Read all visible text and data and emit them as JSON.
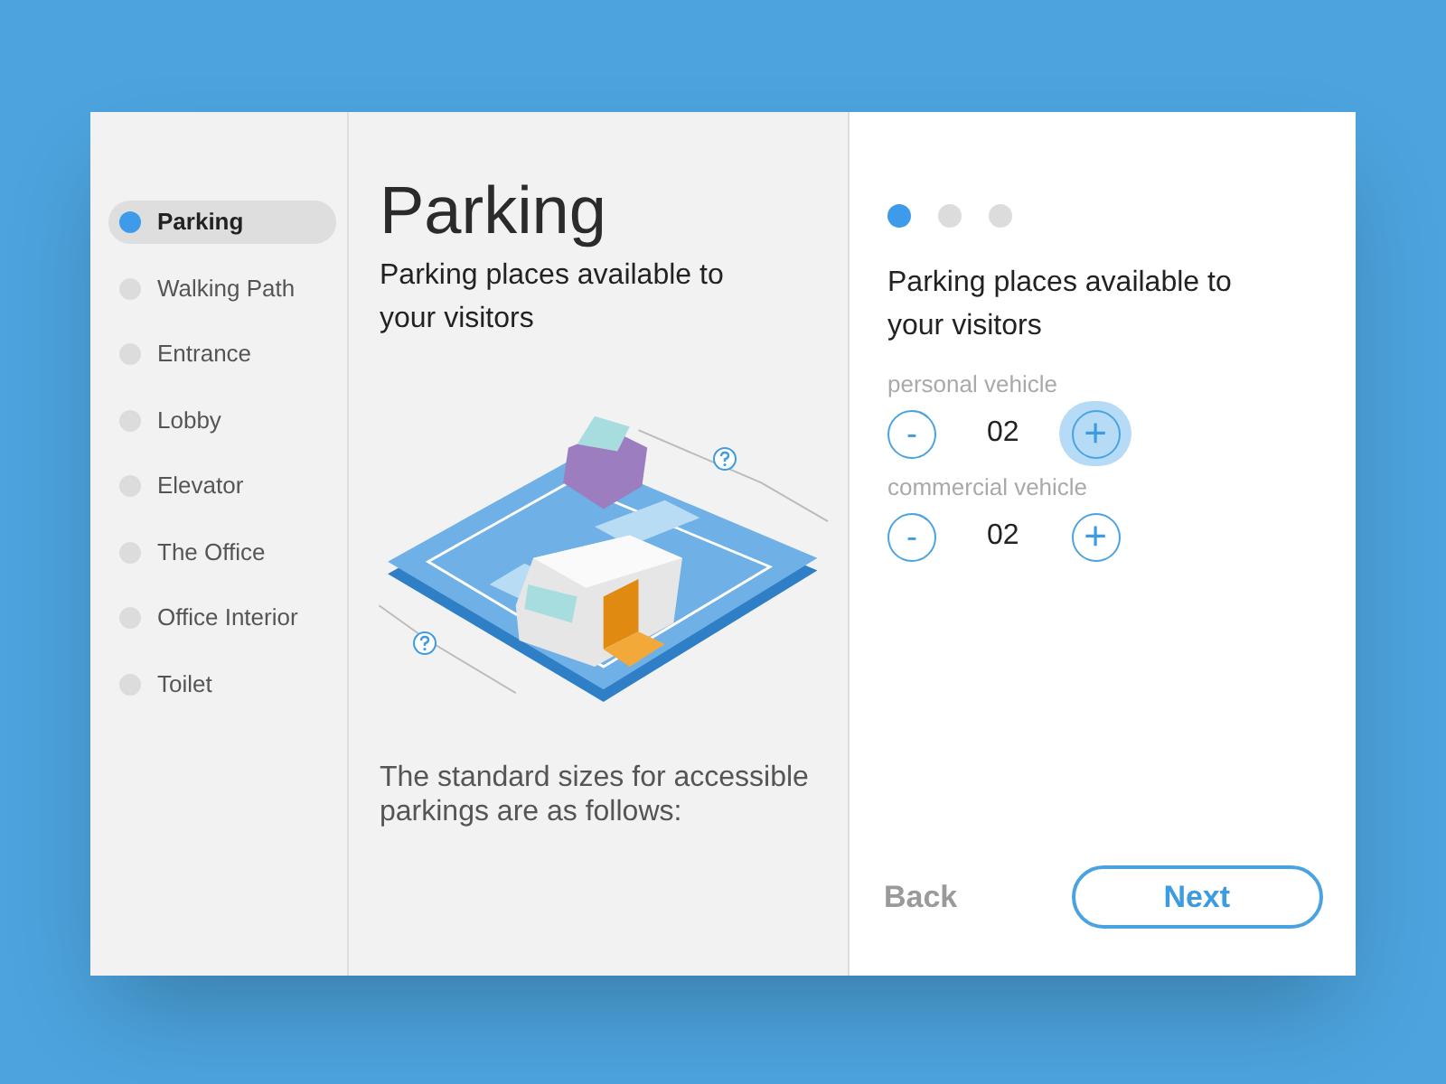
{
  "sidebar": {
    "items": [
      {
        "label": "Parking",
        "selected": true
      },
      {
        "label": "Walking Path",
        "selected": false
      },
      {
        "label": "Entrance",
        "selected": false
      },
      {
        "label": "Lobby",
        "selected": false
      },
      {
        "label": "Elevator",
        "selected": false
      },
      {
        "label": "The Office",
        "selected": false
      },
      {
        "label": "Office Interior",
        "selected": false
      },
      {
        "label": "Toilet",
        "selected": false
      }
    ]
  },
  "content": {
    "title": "Parking",
    "subtitle": "Parking places available to your visitors",
    "note": "The standard sizes for accessible parkings are as follows:"
  },
  "form": {
    "steps": [
      {
        "selected": true
      },
      {
        "selected": false
      },
      {
        "selected": false
      }
    ],
    "heading": "Parking places available to your visitors",
    "counters": [
      {
        "label": "personal vehicle",
        "minus": "-",
        "value": "02",
        "plus": "+",
        "highlighted": true
      },
      {
        "label": "commercial vehicle",
        "minus": "-",
        "value": "02",
        "plus": "+",
        "highlighted": false
      }
    ],
    "back": "Back",
    "next": "Next"
  }
}
